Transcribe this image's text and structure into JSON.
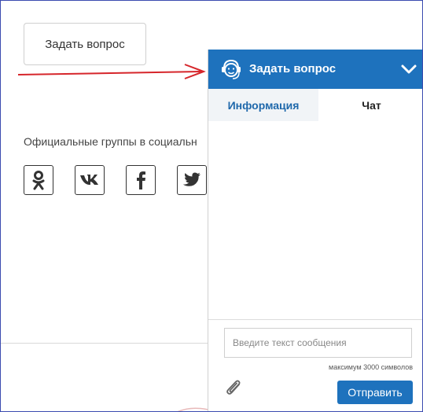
{
  "page": {
    "ask_button_label": "Задать вопрос",
    "official_groups_text": "Официальные группы в социальн",
    "social_icons": [
      "odnoklassniki-icon",
      "vk-icon",
      "facebook-icon",
      "twitter-icon"
    ]
  },
  "widget": {
    "title": "Задать вопрос",
    "tabs": [
      {
        "label": "Информация",
        "active": true
      },
      {
        "label": "Чат",
        "active": false
      }
    ],
    "message_placeholder": "Введите текст сообщения",
    "max_hint": "максимум 3000 символов",
    "send_label": "Отправить"
  },
  "colors": {
    "accent": "#1e72bd",
    "arrow": "#d6262b",
    "frame_border": "#3b4bb0"
  }
}
